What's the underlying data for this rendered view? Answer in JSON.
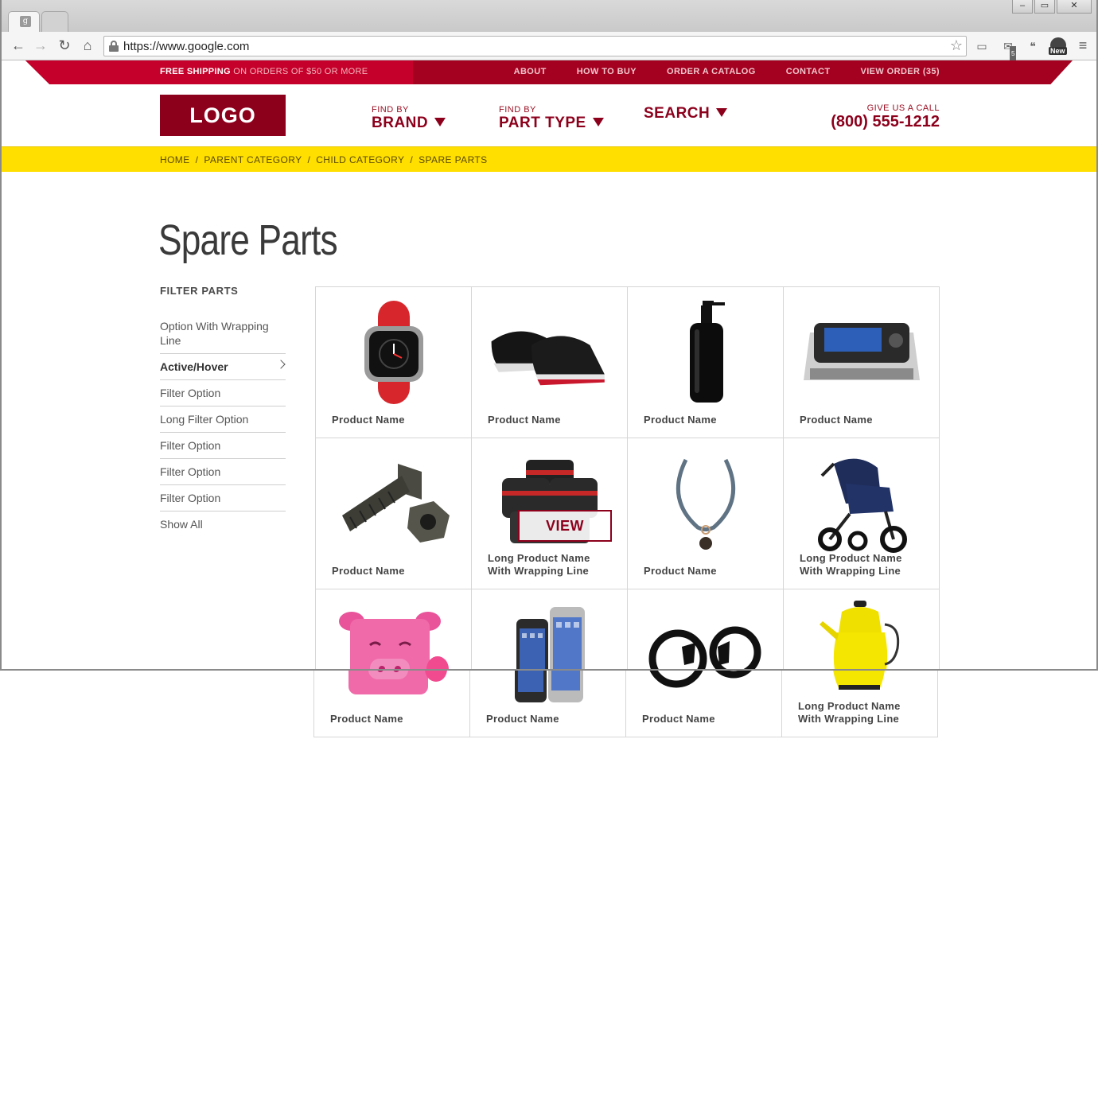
{
  "browser": {
    "url": "https://www.google.com",
    "tab_favicon": "g",
    "new_badge": "New",
    "mail_count": "5"
  },
  "topbar": {
    "shipping_bold": "FREE SHIPPING",
    "shipping_rest": "ON ORDERS OF $50 OR MORE",
    "links": [
      "ABOUT",
      "HOW TO BUY",
      "ORDER A CATALOG",
      "CONTACT",
      "VIEW ORDER (35)"
    ],
    "colors": {
      "dark": "#a4001f",
      "light": "#c5002a"
    }
  },
  "header": {
    "logo": "LOGO",
    "nav": [
      {
        "small": "FIND BY",
        "big": "BRAND"
      },
      {
        "small": "FIND BY",
        "big": "PART TYPE"
      },
      {
        "small": "",
        "big": "SEARCH"
      }
    ],
    "call_label": "GIVE US A CALL",
    "phone": "(800) 555-1212"
  },
  "breadcrumb": [
    "HOME",
    "PARENT CATEGORY",
    "CHILD CATEGORY",
    "SPARE PARTS"
  ],
  "page_title": "Spare Parts",
  "filters": {
    "heading": "FILTER PARTS",
    "items": [
      "Option With Wrapping Line",
      "Active/Hover",
      "Filter Option",
      "Long Filter Option",
      "Filter Option",
      "Filter Option",
      "Filter Option",
      "Show All"
    ]
  },
  "products": [
    {
      "name": "Product Name",
      "icon": "watch-icon"
    },
    {
      "name": "Product Name",
      "icon": "sneakers-icon"
    },
    {
      "name": "Product Name",
      "icon": "bottle-icon"
    },
    {
      "name": "Product Name",
      "icon": "device-icon"
    },
    {
      "name": "Product Name",
      "icon": "bolt-icon"
    },
    {
      "name": "Long Product Name With Wrapping Line",
      "icon": "cookware-icon"
    },
    {
      "name": "Product Name",
      "icon": "necklace-icon"
    },
    {
      "name": "Long Product Name With Wrapping Line",
      "icon": "stroller-icon"
    },
    {
      "name": "Product Name",
      "icon": "pig-toy-icon"
    },
    {
      "name": "Product Name",
      "icon": "phones-icon"
    },
    {
      "name": "Product Name",
      "icon": "controllers-icon"
    },
    {
      "name": "Long Product Name With Wrapping Line",
      "icon": "kettle-icon"
    }
  ],
  "view_button": "VIEW"
}
